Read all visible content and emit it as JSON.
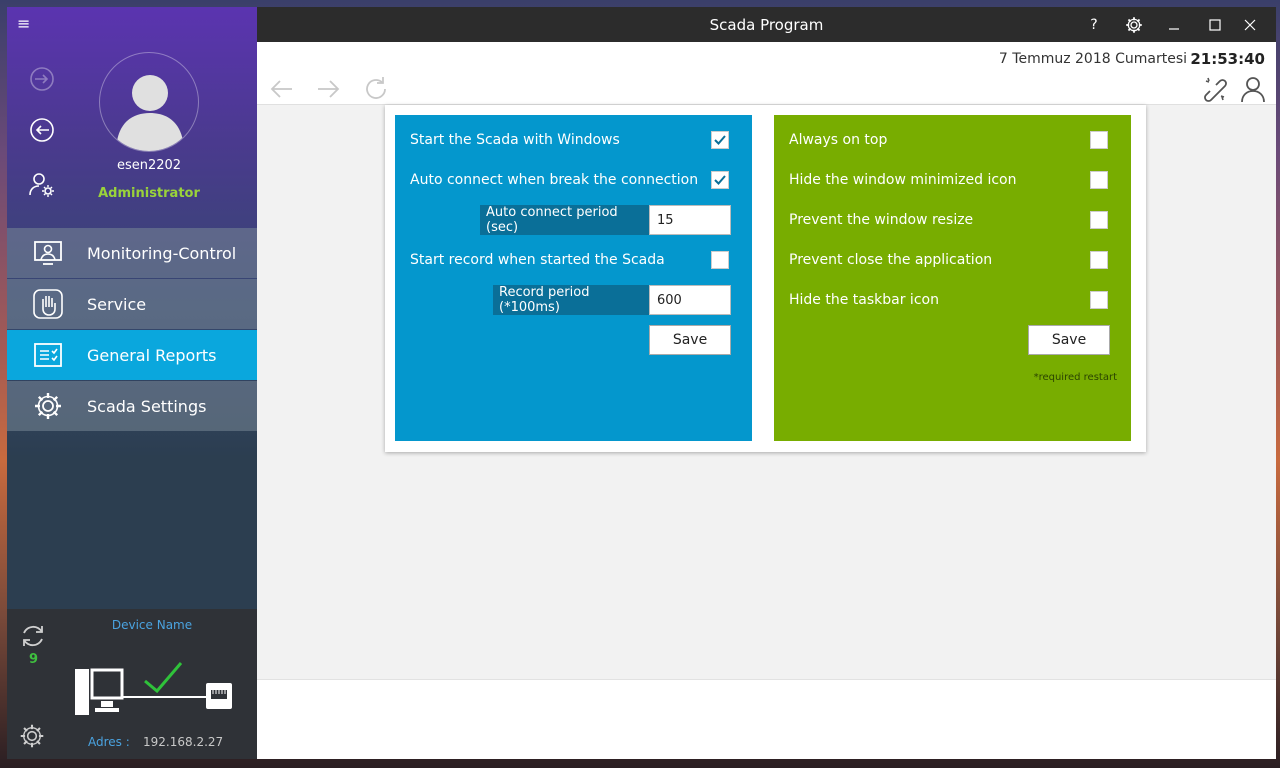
{
  "window": {
    "title": "Scada Program",
    "help_label": "?"
  },
  "topbar": {
    "date": "7 Temmuz 2018 Cumartesi",
    "time": "21:53:40"
  },
  "user": {
    "name": "esen2202",
    "role": "Administrator"
  },
  "menu": [
    {
      "label": "Monitoring-Control",
      "icon": "monitor-user-icon"
    },
    {
      "label": "Service",
      "icon": "hand-icon"
    },
    {
      "label": "General Reports",
      "icon": "report-checklist-icon",
      "active": true
    },
    {
      "label": "Scada Settings",
      "icon": "gear-icon"
    }
  ],
  "device": {
    "name_label": "Device Name",
    "sync_count": "9",
    "address_label": "Adres :",
    "address_value": "192.168.2.27"
  },
  "left_panel": {
    "start_with_windows": {
      "label": "Start the Scada with Windows",
      "checked": true
    },
    "auto_connect": {
      "label": "Auto connect when break the connection",
      "checked": true
    },
    "auto_connect_period": {
      "label": "Auto connect period (sec)",
      "value": "15"
    },
    "start_record": {
      "label": "Start record when started the Scada",
      "checked": false
    },
    "record_period": {
      "label": "Record period (*100ms)",
      "value": "600"
    },
    "save_label": "Save"
  },
  "right_panel": {
    "always_on_top": {
      "label": "Always on top",
      "checked": false
    },
    "hide_min_icon": {
      "label": "Hide the window minimized icon",
      "checked": false
    },
    "prevent_resize": {
      "label": "Prevent the window resize",
      "checked": false
    },
    "prevent_close": {
      "label": "Prevent close the application",
      "checked": false
    },
    "hide_taskbar": {
      "label": "Hide the taskbar icon",
      "checked": false
    },
    "save_label": "Save",
    "note": "*required restart"
  },
  "colors": {
    "accent_blue": "#0497cd",
    "accent_green": "#78ad00",
    "menu_active": "#0aa7dd",
    "role_green": "#9ad33a"
  }
}
